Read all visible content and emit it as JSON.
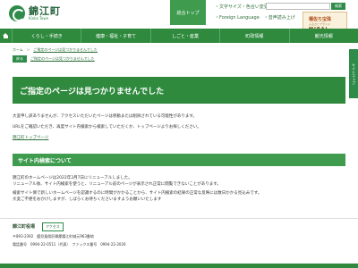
{
  "header": {
    "logo_title": "錦江町",
    "logo_sub": "Kinko Town",
    "top_button": "総合トップ",
    "util_line1": "・文字サイズ・色合い変更　・ふりがな　カスタム検索",
    "util_line2": "・Foreign Language　・音声読み上げ",
    "search_placeholder": "",
    "search_button": "検索",
    "banner_line1": "種佐ち宝珠",
    "banner_line2": "ふるさとブランド",
    "banner_line3": "MIRAI"
  },
  "nav": {
    "items": [
      "くらし・手続き",
      "健康・福祉・子育て",
      "しごと・産業",
      "町政情報",
      "観光情報"
    ]
  },
  "breadcrumb": {
    "home": "ホーム",
    "current": "ご指定のページは見つかりませんでした"
  },
  "crumb2": {
    "tag": "戻る",
    "text": "ご指定のページは見つかりませんでした"
  },
  "side_tab": "サイトマップ",
  "main": {
    "title": "ご指定のページは見つかりませんでした",
    "para1": "大変申し訳ありませんが、アクセスいただいたページは移動または削除されている可能性があります。",
    "para2": "URLをご確認いただき、再度サイト内検索から検索していただくか、トップページよりお探しください。",
    "top_link": "錦江町トップページ"
  },
  "section": {
    "title": "サイト内検索について",
    "line1": "錦江町のホームページは2022年3月7日にリニューアルしました。",
    "line2": "リニューアル後、サイト内検索を使うと、リニューアル前のページが表示され正常に閲覧できないことがあります。",
    "line3": "検索サイト側で新しいホームページを認識するのに時間がかかることから、サイト内検索の結果の正常な反映には数日かかる見込みです。",
    "line4": "大変ご不便をおかけしますが、しばらくお待ちくださいますようお願いいたします"
  },
  "footer": {
    "name": "錦江町役場",
    "access": "アクセス",
    "address": "〒893-2392　鹿児島県肝属郡錦江町城元963番地",
    "tel": "電話番号　0994-22-0511（代表）　ファックス番号　0994-22-2026"
  },
  "colors": {
    "primary_green": "#2f8a3e",
    "accent_green": "#3f9c4f"
  }
}
